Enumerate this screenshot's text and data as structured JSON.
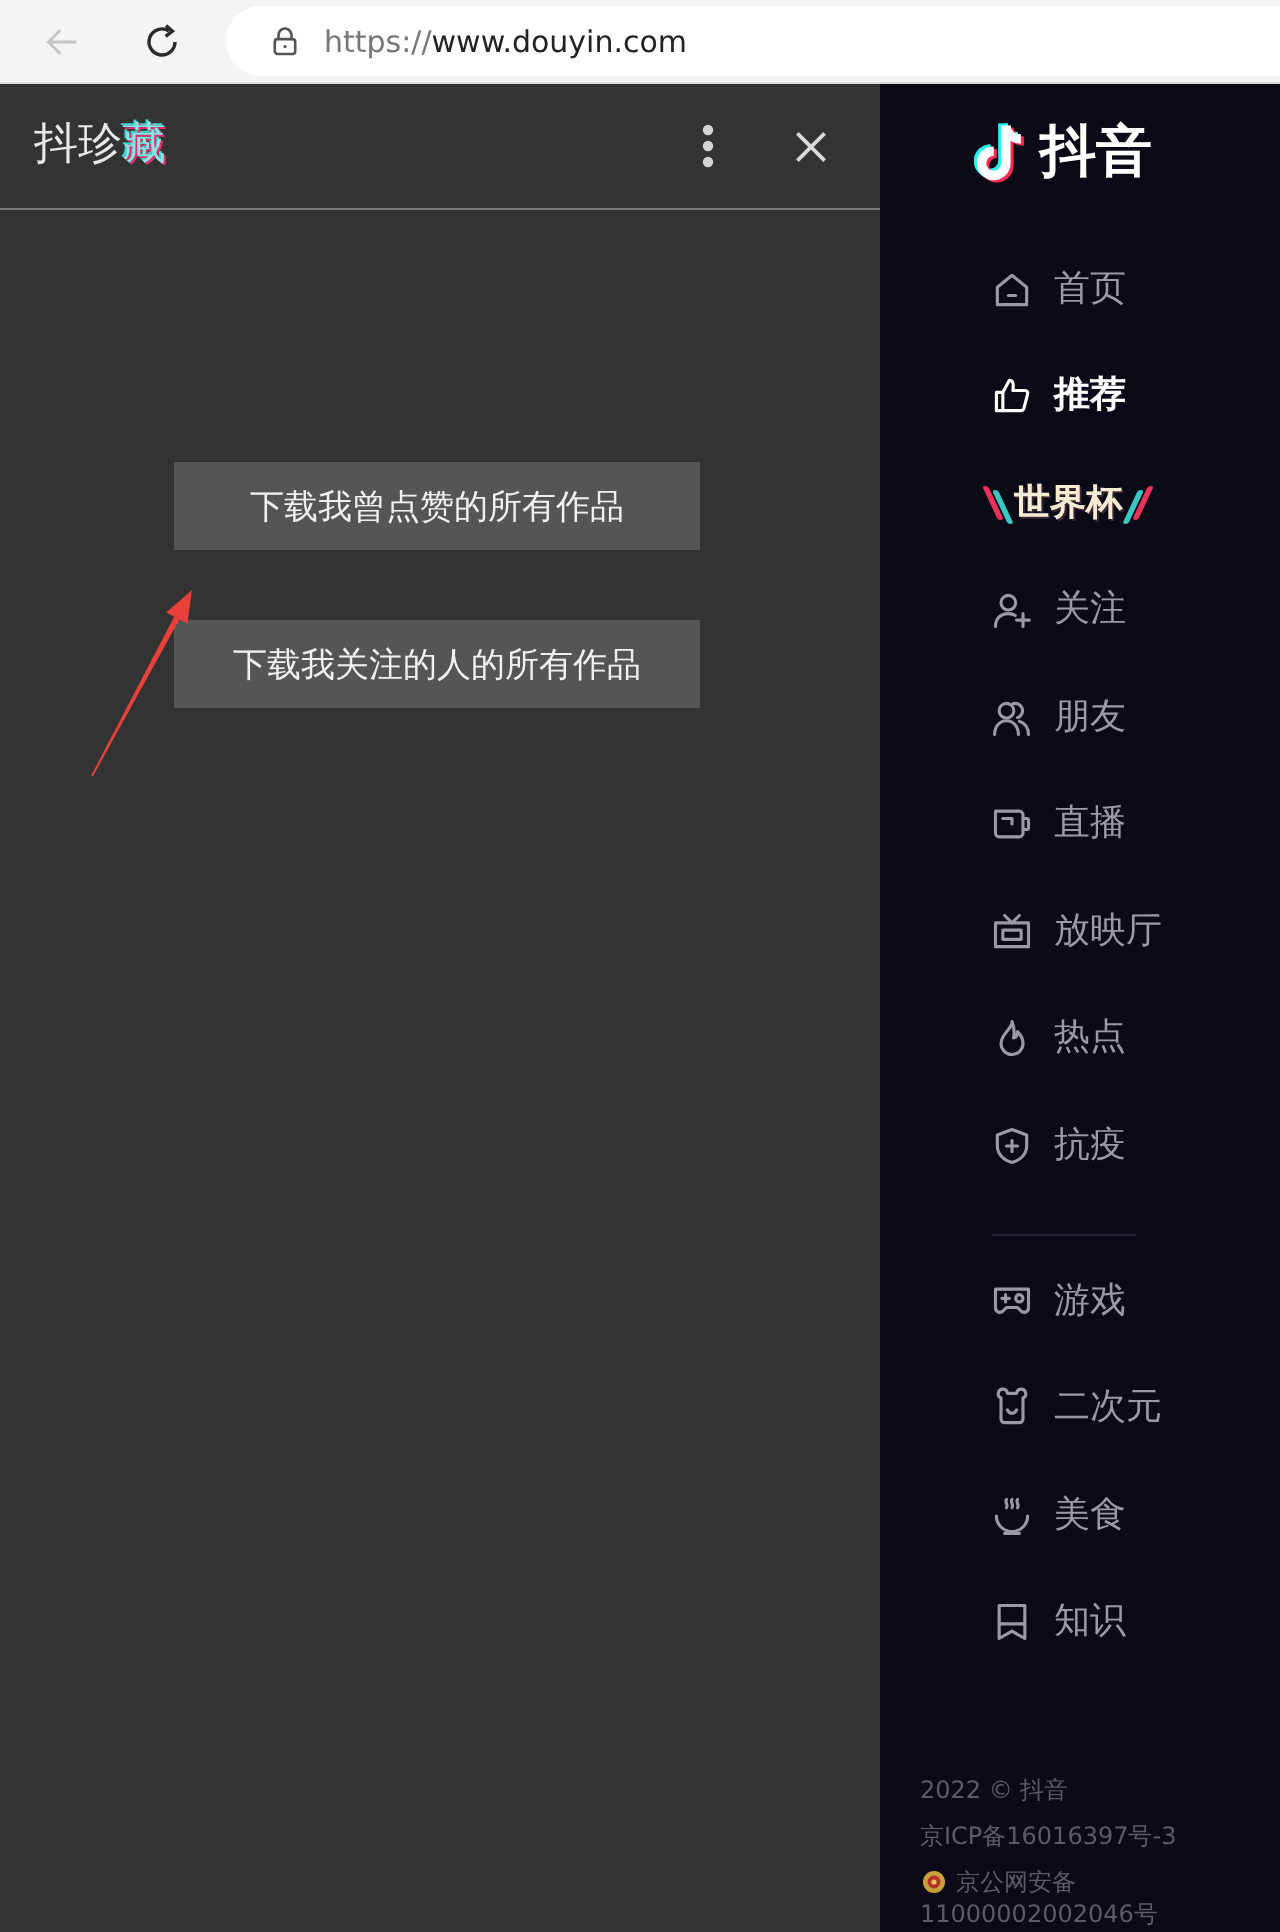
{
  "browser": {
    "back": {
      "disabled": true
    },
    "address": {
      "scheme": "https://",
      "host": "www.douyin.com"
    }
  },
  "panel": {
    "title": {
      "main": "抖珍",
      "accent": "藏"
    },
    "actions": [
      "下载我曾点赞的所有作品",
      "下载我关注的人的所有作品"
    ]
  },
  "sidebar": {
    "logo": "抖音",
    "groups": [
      {
        "items": [
          {
            "kind": "link",
            "label": "首页",
            "selected": false
          },
          {
            "kind": "link",
            "label": "推荐",
            "selected": true
          },
          {
            "kind": "banner",
            "label": "世界杯",
            "selected": false
          },
          {
            "kind": "link",
            "label": "关注",
            "selected": false
          },
          {
            "kind": "link",
            "label": "朋友",
            "selected": false
          },
          {
            "kind": "link",
            "label": "直播",
            "selected": false
          },
          {
            "kind": "link",
            "label": "放映厅",
            "selected": false
          },
          {
            "kind": "link",
            "label": "热点",
            "selected": false
          },
          {
            "kind": "link",
            "label": "抗疫",
            "selected": false
          }
        ]
      },
      {
        "items": [
          {
            "kind": "link",
            "label": "游戏",
            "selected": false
          },
          {
            "kind": "link",
            "label": "二次元",
            "selected": false
          },
          {
            "kind": "link",
            "label": "美食",
            "selected": false
          },
          {
            "kind": "link",
            "label": "知识",
            "selected": false
          }
        ]
      }
    ],
    "footer": {
      "copyright": "2022 © 抖音",
      "icp": "京ICP备16016397号-3",
      "police": "京公网安备 11000002002046号"
    }
  }
}
